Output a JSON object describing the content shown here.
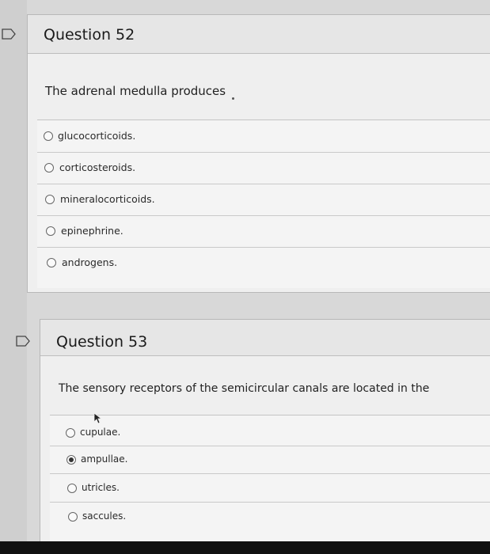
{
  "questions": [
    {
      "title": "Question 52",
      "text": "The adrenal medulla produces",
      "options": [
        {
          "label": "glucocorticoids.",
          "selected": false
        },
        {
          "label": "corticosteroids.",
          "selected": false
        },
        {
          "label": "mineralocorticoids.",
          "selected": false
        },
        {
          "label": "epinephrine.",
          "selected": false
        },
        {
          "label": "androgens.",
          "selected": false
        }
      ]
    },
    {
      "title": "Question 53",
      "text": "The sensory receptors of the semicircular canals are located in the",
      "options": [
        {
          "label": "cupulae.",
          "selected": false
        },
        {
          "label": "ampullae.",
          "selected": true
        },
        {
          "label": "utricles.",
          "selected": false
        },
        {
          "label": "saccules.",
          "selected": false
        }
      ]
    }
  ],
  "icons": {
    "flag": "flag-icon",
    "cursor": "mouse-pointer-icon"
  }
}
